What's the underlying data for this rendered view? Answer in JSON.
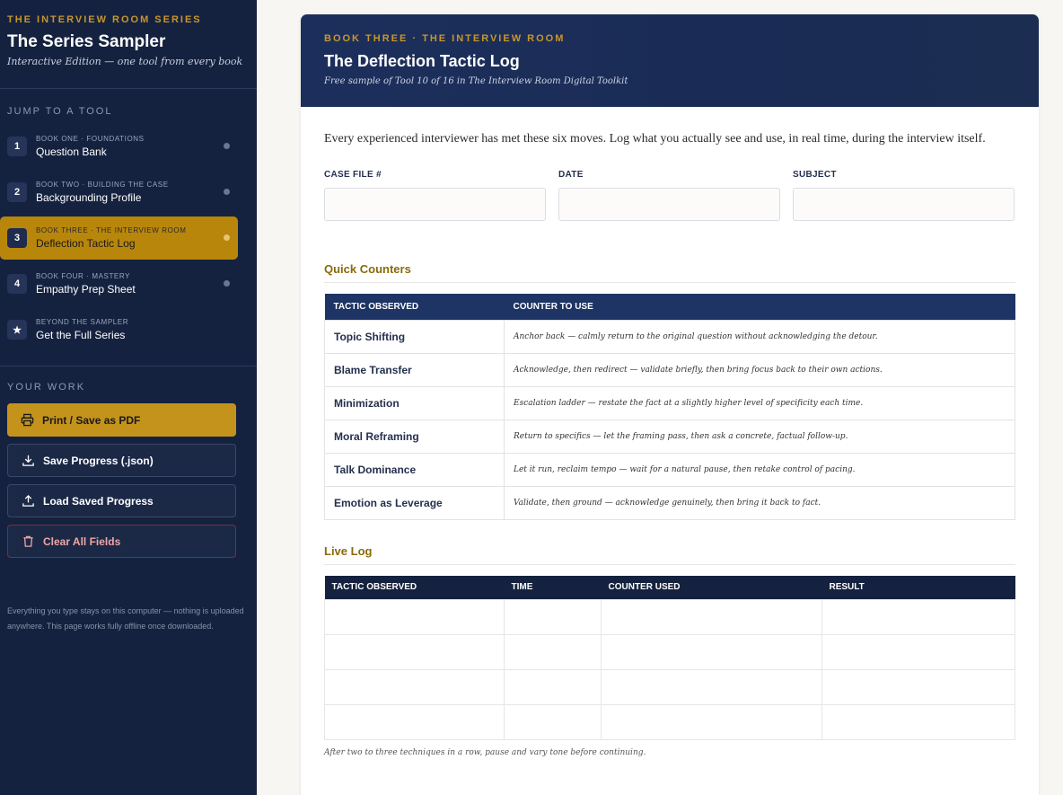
{
  "sidebar": {
    "series_label": "THE INTERVIEW ROOM SERIES",
    "title": "The Series Sampler",
    "subtitle": "Interactive Edition — one tool from every book",
    "jump_label": "JUMP TO A TOOL",
    "nav": [
      {
        "badge": "1",
        "book": "BOOK ONE · FOUNDATIONS",
        "name": "Question Bank",
        "active": false
      },
      {
        "badge": "2",
        "book": "BOOK TWO · BUILDING THE CASE",
        "name": "Backgrounding Profile",
        "active": false
      },
      {
        "badge": "3",
        "book": "BOOK THREE · THE INTERVIEW ROOM",
        "name": "Deflection Tactic Log",
        "active": true
      },
      {
        "badge": "4",
        "book": "BOOK FOUR · MASTERY",
        "name": "Empathy Prep Sheet",
        "active": false
      },
      {
        "badge": "★",
        "book": "BEYOND THE SAMPLER",
        "name": "Get the Full Series",
        "active": false
      }
    ],
    "work_label": "YOUR WORK",
    "buttons": {
      "print": "Print / Save as PDF",
      "save": "Save Progress (.json)",
      "load": "Load Saved Progress",
      "clear": "Clear All Fields"
    },
    "privacy_note": "Everything you type stays on this computer — nothing is uploaded anywhere. This page works fully offline once downloaded."
  },
  "main": {
    "book_label": "BOOK THREE · THE INTERVIEW ROOM",
    "title": "The Deflection Tactic Log",
    "subtitle": "Free sample of Tool 10 of 16 in The Interview Room Digital Toolkit",
    "intro": "Every experienced interviewer has met these six moves. Log what you actually see and use, in real time, during the interview itself.",
    "fields": [
      {
        "label": "CASE FILE #",
        "value": "",
        "placeholder": ""
      },
      {
        "label": "DATE",
        "value": "",
        "placeholder": ""
      },
      {
        "label": "SUBJECT",
        "value": "",
        "placeholder": ""
      }
    ],
    "quick_counters": {
      "title": "Quick Counters",
      "headers": [
        "TACTIC OBSERVED",
        "COUNTER TO USE"
      ],
      "rows": [
        [
          "Topic Shifting",
          "Anchor back — calmly return to the original question without acknowledging the detour."
        ],
        [
          "Blame Transfer",
          "Acknowledge, then redirect — validate briefly, then bring focus back to their own actions."
        ],
        [
          "Minimization",
          "Escalation ladder — restate the fact at a slightly higher level of specificity each time."
        ],
        [
          "Moral Reframing",
          "Return to specifics — let the framing pass, then ask a concrete, factual follow-up."
        ],
        [
          "Talk Dominance",
          "Let it run, reclaim tempo — wait for a natural pause, then retake control of pacing."
        ],
        [
          "Emotion as Leverage",
          "Validate, then ground — acknowledge genuinely, then bring it back to fact."
        ]
      ]
    },
    "live_log": {
      "title": "Live Log",
      "headers": [
        "TACTIC OBSERVED",
        "TIME",
        "COUNTER USED",
        "RESULT"
      ],
      "rows": [
        [
          "",
          "",
          "",
          ""
        ],
        [
          "",
          "",
          "",
          ""
        ],
        [
          "",
          "",
          "",
          ""
        ],
        [
          "",
          "",
          "",
          ""
        ]
      ],
      "footnote": "After two to three techniques in a row, pause and vary tone before continuing."
    }
  }
}
